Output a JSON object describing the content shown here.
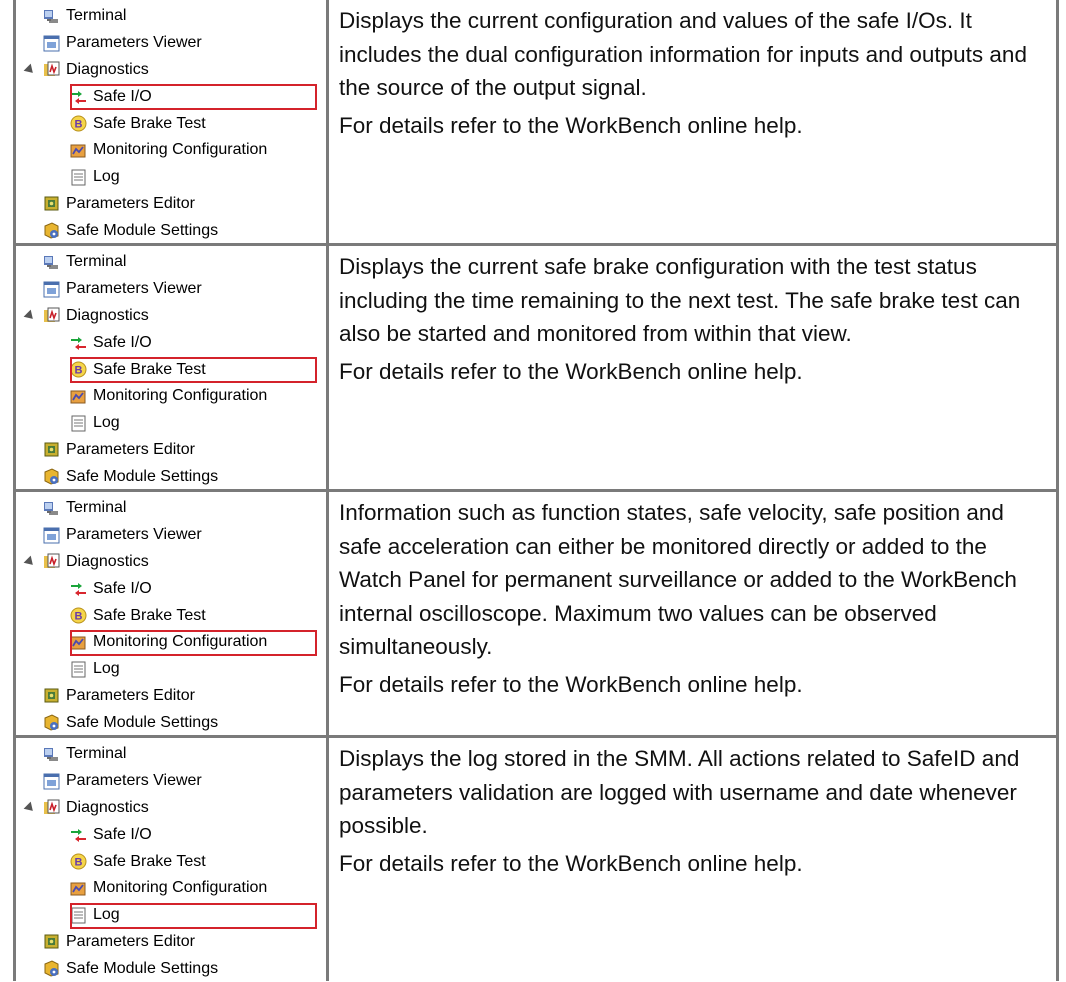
{
  "tree_labels": {
    "terminal": "Terminal",
    "parameters_viewer": "Parameters Viewer",
    "diagnostics": "Diagnostics",
    "safe_io": "Safe I/O",
    "safe_brake_test": "Safe Brake Test",
    "monitoring_configuration": "Monitoring Configuration",
    "log": "Log",
    "parameters_editor": "Parameters Editor",
    "safe_module_settings": "Safe Module Settings"
  },
  "rows": [
    {
      "selected": "Safe I/O",
      "description": [
        "Displays the current configuration and values of the safe I/Os. It includes the dual configuration information for inputs and out­puts and the source of the output signal."
      ],
      "help": "For details refer to the WorkBench online help."
    },
    {
      "selected": "Safe Brake Test",
      "description": [
        "Displays the current safe brake configuration with the test status including the time remaining to the next test. The safe brake test can also be started and monitored from within that view."
      ],
      "help": "For details refer to the WorkBench online help."
    },
    {
      "selected": "Monitoring Configuration",
      "description": [
        "Information such as function states, safe velocity, safe pos­ition and safe acceleration can either be monitored directly or added to the Watch Panel for permanent surveillance or added to the WorkBench internal oscilloscope. Maximum two values can be observed simultaneously."
      ],
      "help": "For details refer to the WorkBench online help."
    },
    {
      "selected": "Log",
      "description": [
        "Displays the log stored in the SMM. All actions related to SafeID and parameters validation are logged with username and date whenever possible."
      ],
      "help": "For details refer to the WorkBench online help."
    }
  ],
  "colors": {
    "border": "#7a7a7a",
    "highlight": "#d4232b"
  },
  "icons": [
    "terminal-icon",
    "parameters-viewer-icon",
    "diagnostics-icon",
    "safe-io-icon",
    "safe-brake-test-icon",
    "monitoring-configuration-icon",
    "log-icon",
    "parameters-editor-icon",
    "safe-module-settings-icon"
  ]
}
